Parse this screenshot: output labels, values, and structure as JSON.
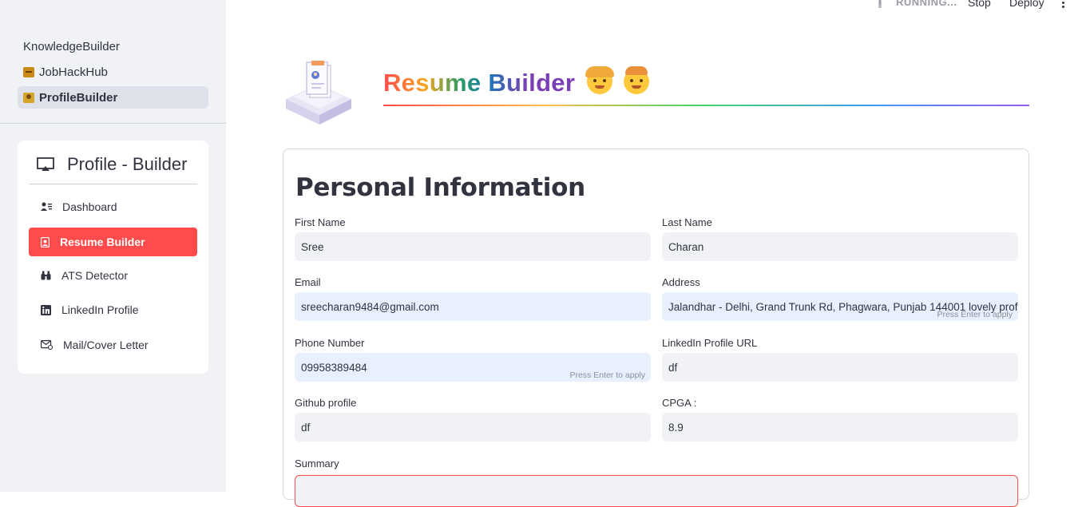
{
  "header": {
    "status": "RUNNING...",
    "stop_label": "Stop",
    "deploy_label": "Deploy"
  },
  "sidebar": {
    "pages": [
      {
        "label": "KnowledgeBuilder",
        "icon": "none"
      },
      {
        "label": "JobHackHub",
        "icon": "briefcase-emoji"
      },
      {
        "label": "ProfileBuilder",
        "icon": "person-emoji",
        "active": true
      }
    ],
    "menu": {
      "title": "Profile - Builder",
      "items": [
        {
          "label": "Dashboard",
          "icon": "person-lines-icon"
        },
        {
          "label": "Resume Builder",
          "icon": "person-badge-icon",
          "active": true
        },
        {
          "label": "ATS Detector",
          "icon": "binoculars-icon"
        },
        {
          "label": "LinkedIn Profile",
          "icon": "linkedin-icon"
        },
        {
          "label": "Mail/Cover Letter",
          "icon": "envelope-icon"
        }
      ],
      "active_color": "#ff4b4b"
    }
  },
  "main": {
    "title": "Resume Builder",
    "section_title": "Personal Information",
    "hint_text": "Press Enter to apply",
    "fields": {
      "first_name": {
        "label": "First Name",
        "value": "Sree"
      },
      "last_name": {
        "label": "Last Name",
        "value": "Charan"
      },
      "email": {
        "label": "Email",
        "value": "sreecharan9484@gmail.com"
      },
      "address": {
        "label": "Address",
        "value": "Jalandhar - Delhi, Grand Trunk Rd, Phagwara, Punjab 144001 lovely prof"
      },
      "phone": {
        "label": "Phone Number",
        "value": "09958389484"
      },
      "linkedin": {
        "label": "LinkedIn Profile URL",
        "value": "df"
      },
      "github": {
        "label": "Github profile",
        "value": "df"
      },
      "cgpa": {
        "label": "CPGA :",
        "value": "8.9"
      },
      "summary": {
        "label": "Summary",
        "value": ""
      }
    }
  }
}
